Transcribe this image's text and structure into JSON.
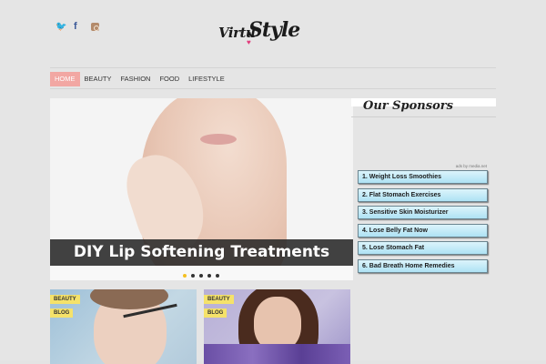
{
  "brand": {
    "logo_word1": "Virtu",
    "logo_word2": "Style"
  },
  "social": [
    {
      "name": "twitter",
      "glyph": "🐦"
    },
    {
      "name": "facebook",
      "glyph": "f"
    },
    {
      "name": "instagram",
      "glyph": ""
    }
  ],
  "nav": {
    "items": [
      {
        "label": "HOME",
        "active": true
      },
      {
        "label": "BEAUTY",
        "active": false
      },
      {
        "label": "FASHION",
        "active": false
      },
      {
        "label": "FOOD",
        "active": false
      },
      {
        "label": "LIFESTYLE",
        "active": false
      }
    ]
  },
  "slider": {
    "caption": "DIY Lip Softening Treatments",
    "dots": 5,
    "active_dot": 0
  },
  "sponsors": {
    "title": "Our Sponsors",
    "ads_by": "ads by media.net",
    "items": [
      "1. Weight Loss Smoothies",
      "2. Flat Stomach Exercises",
      "3. Sensitive Skin Moisturizer",
      "4. Lose Belly Fat Now",
      "5. Lose Stomach Fat",
      "6. Bad Breath Home Remedies"
    ]
  },
  "posts": [
    {
      "tags": [
        "BEAUTY",
        "BLOG"
      ]
    },
    {
      "tags": [
        "BEAUTY",
        "BLOG"
      ]
    }
  ],
  "colors": {
    "nav_active": "#f2a7a3",
    "tag_bg": "#f5e26a",
    "ad_bg": "#aee2f4"
  }
}
